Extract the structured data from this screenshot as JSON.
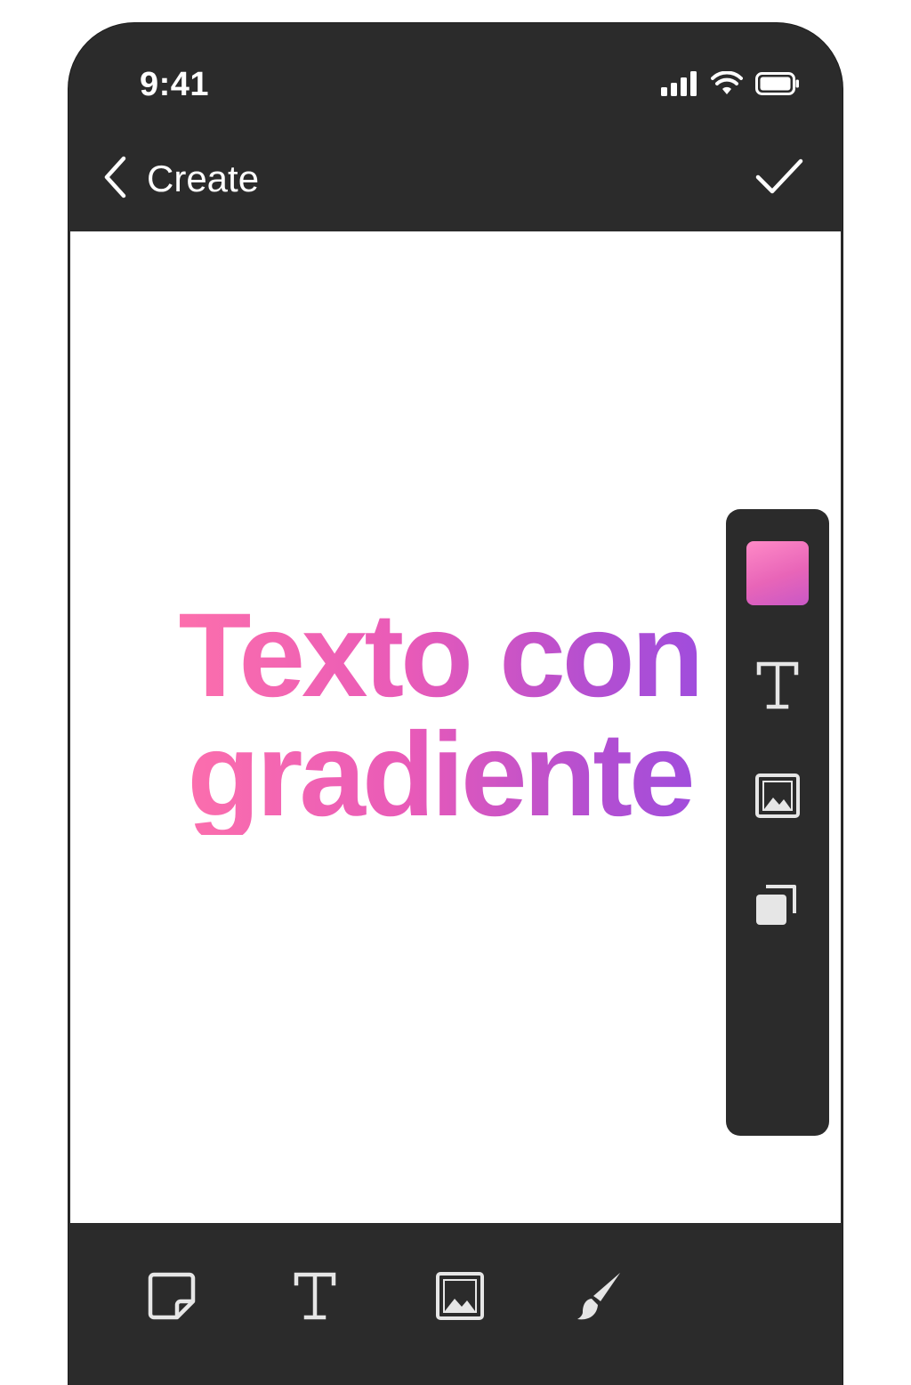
{
  "status_bar": {
    "time": "9:41",
    "icons": [
      "cellular-signal-icon",
      "wifi-icon",
      "battery-icon"
    ]
  },
  "nav": {
    "back_label": "Create",
    "back_icon": "chevron-left-icon",
    "done_icon": "checkmark-icon"
  },
  "canvas": {
    "text": "Texto con\ngradiente",
    "gradient_colors": [
      "#ff72ab",
      "#e85ab8",
      "#b54fd0",
      "#9a4ce0"
    ]
  },
  "side_toolbar": {
    "items": [
      "color-swatch",
      "text-style-icon",
      "image-icon",
      "layers-icon"
    ],
    "swatch_colors": [
      "#ff8ac7",
      "#c958c6"
    ]
  },
  "bottom_toolbar": {
    "items": [
      "sticker-icon",
      "text-icon",
      "image-icon",
      "brush-icon"
    ]
  },
  "colors": {
    "chrome": "#2b2b2b",
    "canvas_bg": "#ffffff",
    "icon_color": "#e6e6e6"
  }
}
